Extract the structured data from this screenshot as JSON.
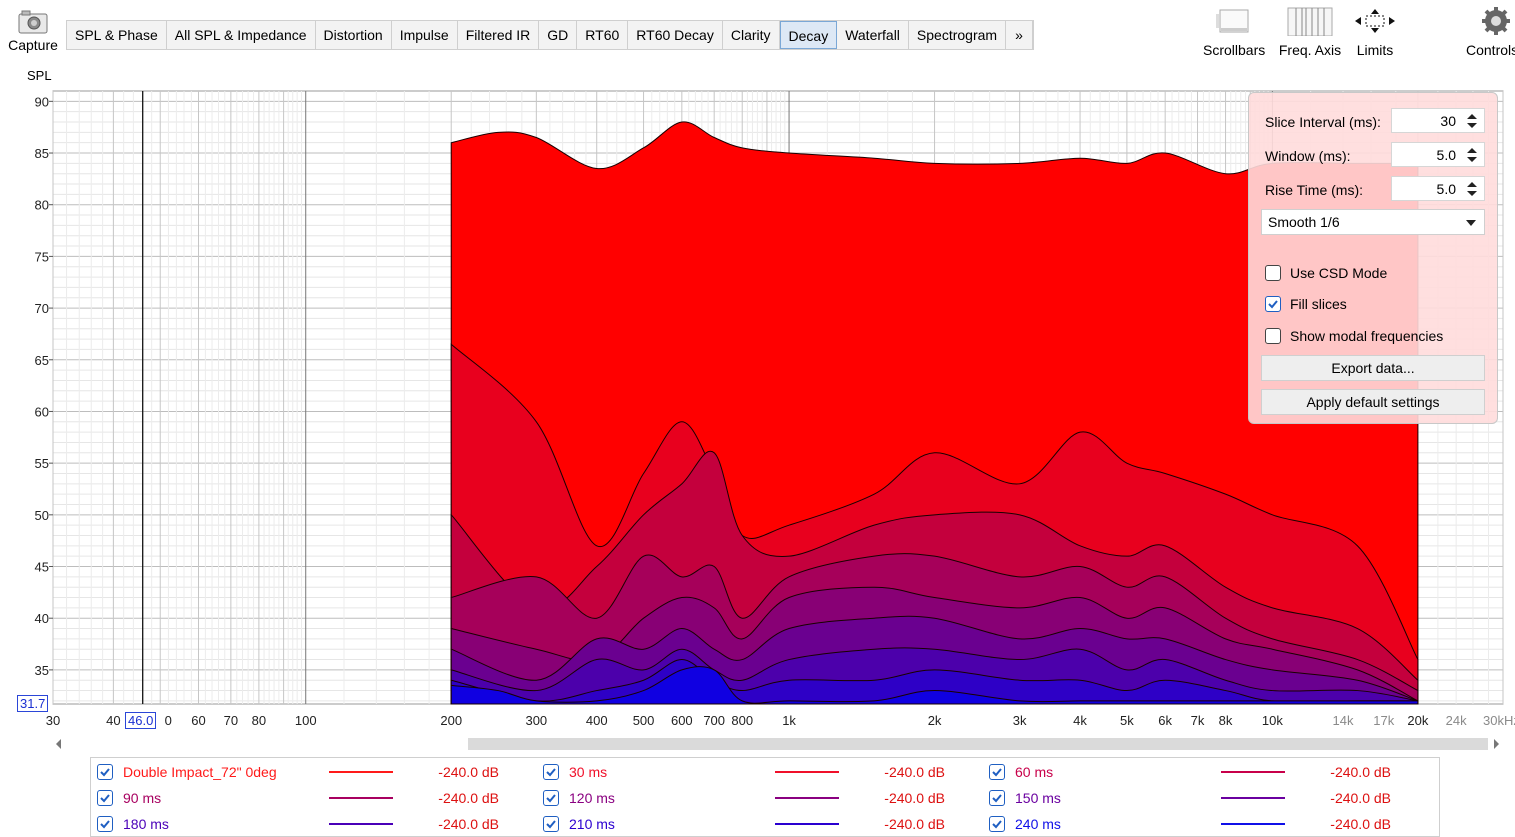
{
  "toolbar": {
    "capture_label": "Capture",
    "tabs": [
      "SPL & Phase",
      "All SPL & Impedance",
      "Distortion",
      "Impulse",
      "Filtered IR",
      "GD",
      "RT60",
      "RT60 Decay",
      "Clarity",
      "Decay",
      "Waterfall",
      "Spectrogram"
    ],
    "active_tab": "Decay",
    "more_label": "»",
    "scrollbars_label": "Scrollbars",
    "freq_axis_label": "Freq. Axis",
    "limits_label": "Limits",
    "controls_label": "Controls"
  },
  "plot": {
    "y_axis_label": "SPL",
    "cursor_y": "31.7",
    "cursor_x": "46.0",
    "y_ticks": [
      "90",
      "85",
      "80",
      "75",
      "70",
      "65",
      "60",
      "55",
      "50",
      "45",
      "40",
      "35"
    ],
    "x_ticks": [
      "30",
      "40",
      "0",
      "60",
      "70",
      "80",
      "100",
      "200",
      "300",
      "400",
      "500",
      "600",
      "700",
      "800",
      "1k",
      "2k",
      "3k",
      "4k",
      "5k",
      "6k",
      "7k",
      "8k",
      "10k",
      "14k",
      "17k",
      "20k",
      "24k",
      "30kHz"
    ]
  },
  "chart_data": {
    "type": "area",
    "xlabel": "",
    "ylabel": "SPL",
    "x_scale": "log",
    "xlim": [
      30,
      30000
    ],
    "ylim": [
      31.7,
      91
    ],
    "grid": true,
    "series": [
      {
        "name": "Double Impact_72\" 0deg",
        "color": "#ff0000",
        "x": [
          200,
          250,
          300,
          400,
          500,
          600,
          700,
          800,
          1000,
          1500,
          2000,
          3000,
          4000,
          5000,
          6000,
          8000,
          10000,
          15000,
          20000
        ],
        "y": [
          86,
          87,
          86.5,
          83.5,
          85.5,
          88,
          86.5,
          85.5,
          85,
          84.5,
          84,
          84,
          84.5,
          84,
          85,
          83,
          84,
          84,
          84
        ]
      },
      {
        "name": "30 ms",
        "color": "#e8001e",
        "x": [
          200,
          300,
          400,
          500,
          600,
          700,
          800,
          1000,
          1500,
          2000,
          3000,
          4000,
          5000,
          6000,
          8000,
          10000,
          15000,
          20000
        ],
        "y": [
          66.5,
          59,
          47,
          54,
          59,
          54,
          48,
          49,
          52,
          56,
          53,
          58,
          55,
          54,
          52,
          50,
          47,
          36
        ]
      },
      {
        "name": "60 ms",
        "color": "#c4003d",
        "x": [
          200,
          300,
          400,
          500,
          600,
          700,
          800,
          1000,
          1500,
          2000,
          3000,
          4000,
          5000,
          6000,
          8000,
          10000,
          15000,
          20000
        ],
        "y": [
          50,
          41,
          45,
          50,
          53,
          56,
          48,
          46,
          49,
          50,
          50,
          47,
          46,
          47,
          43,
          41,
          39,
          34
        ]
      },
      {
        "name": "90 ms",
        "color": "#a6005a",
        "x": [
          200,
          300,
          400,
          500,
          600,
          700,
          800,
          1000,
          1500,
          2000,
          3000,
          4000,
          5000,
          6000,
          8000,
          10000,
          15000,
          20000
        ],
        "y": [
          42,
          44,
          40,
          46,
          44,
          45,
          40,
          44,
          46,
          46,
          44,
          45,
          43,
          44,
          40,
          38,
          36,
          33
        ]
      },
      {
        "name": "120 ms",
        "color": "#880075",
        "x": [
          200,
          300,
          400,
          500,
          600,
          700,
          800,
          1000,
          1500,
          2000,
          3000,
          4000,
          5000,
          6000,
          8000,
          10000,
          15000,
          20000
        ],
        "y": [
          39,
          37,
          36,
          40,
          42,
          41,
          38,
          42,
          43,
          42,
          41,
          42,
          40,
          41,
          38,
          37,
          35,
          32
        ]
      },
      {
        "name": "150 ms",
        "color": "#6a0090",
        "x": [
          200,
          300,
          400,
          500,
          600,
          700,
          800,
          1000,
          1500,
          2000,
          3000,
          4000,
          5000,
          6000,
          8000,
          10000,
          15000,
          20000
        ],
        "y": [
          37,
          34,
          38,
          37,
          39,
          37,
          36,
          39,
          40,
          40,
          38,
          39,
          38,
          38,
          36,
          35,
          34,
          32
        ]
      },
      {
        "name": "180 ms",
        "color": "#4c00ab",
        "x": [
          200,
          300,
          400,
          500,
          600,
          700,
          800,
          1000,
          1500,
          2000,
          3000,
          4000,
          5000,
          6000,
          8000,
          10000,
          15000,
          20000
        ],
        "y": [
          35,
          33,
          36,
          35,
          37,
          35,
          34,
          36,
          37,
          37,
          36,
          37,
          35,
          36,
          34,
          33,
          33,
          32
        ]
      },
      {
        "name": "210 ms",
        "color": "#2e00c6",
        "x": [
          200,
          300,
          400,
          500,
          600,
          700,
          800,
          1000,
          1500,
          2000,
          3000,
          4000,
          5000,
          6000,
          8000,
          10000,
          15000,
          20000
        ],
        "y": [
          34,
          32,
          33,
          34,
          36,
          34,
          33,
          34,
          34,
          35,
          34,
          34,
          33,
          34,
          33,
          32,
          32,
          32
        ]
      },
      {
        "name": "240 ms",
        "color": "#1000e1",
        "x": [
          200,
          250,
          300,
          400,
          500,
          600,
          700,
          800,
          1000,
          1500,
          2000,
          3000,
          4000,
          5000,
          6000,
          8000,
          10000,
          15000,
          20000
        ],
        "y": [
          33.5,
          33,
          32,
          32,
          33,
          35,
          35,
          32,
          32,
          32,
          33,
          32,
          32,
          32,
          32,
          32,
          32,
          32,
          32
        ]
      }
    ]
  },
  "settings": {
    "slice_interval_label": "Slice Interval (ms):",
    "slice_interval_value": "30",
    "window_label": "Window (ms):",
    "window_value": "5.0",
    "rise_time_label": "Rise Time (ms):",
    "rise_time_value": "5.0",
    "smoothing_value": "Smooth 1/6",
    "use_csd_label": "Use CSD Mode",
    "use_csd_checked": false,
    "fill_slices_label": "Fill slices",
    "fill_slices_checked": true,
    "modal_label": "Show modal frequencies",
    "modal_checked": false,
    "export_label": "Export data...",
    "defaults_label": "Apply default settings"
  },
  "legend": [
    {
      "name": "Double Impact_72\" 0deg",
      "value": "-240.0 dB",
      "color": "#ff1a1a",
      "checked": true
    },
    {
      "name": "30 ms",
      "value": "-240.0 dB",
      "color": "#f0102a",
      "checked": true
    },
    {
      "name": "60 ms",
      "value": "-240.0 dB",
      "color": "#c8004a",
      "checked": true
    },
    {
      "name": "90 ms",
      "value": "-240.0 dB",
      "color": "#a80060",
      "checked": true
    },
    {
      "name": "120 ms",
      "value": "-240.0 dB",
      "color": "#8a0080",
      "checked": true
    },
    {
      "name": "150 ms",
      "value": "-240.0 dB",
      "color": "#6a00a0",
      "checked": true
    },
    {
      "name": "180 ms",
      "value": "-240.0 dB",
      "color": "#4a00b8",
      "checked": true
    },
    {
      "name": "210 ms",
      "value": "-240.0 dB",
      "color": "#2a00d0",
      "checked": true
    },
    {
      "name": "240 ms",
      "value": "-240.0 dB",
      "color": "#1010e8",
      "checked": true
    }
  ]
}
